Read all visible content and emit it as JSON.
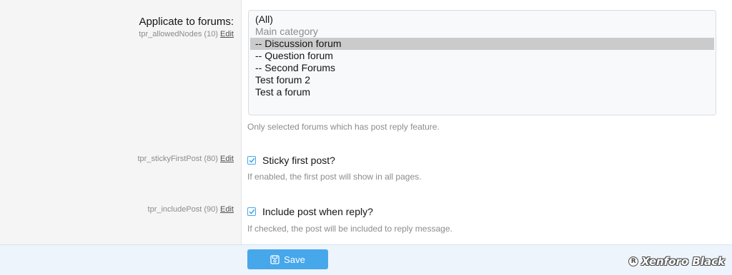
{
  "forums_field": {
    "label": "Applicate to forums:",
    "option_id": "tpr_allowedNodes (10)",
    "edit_label": "Edit",
    "options": [
      {
        "label": "(All)",
        "state": "normal"
      },
      {
        "label": "Main category",
        "state": "disabled"
      },
      {
        "label": "-- Discussion forum",
        "state": "selected"
      },
      {
        "label": "-- Question forum",
        "state": "normal"
      },
      {
        "label": "-- Second Forums",
        "state": "normal"
      },
      {
        "label": "Test forum 2",
        "state": "normal"
      },
      {
        "label": "Test a forum",
        "state": "normal"
      }
    ],
    "hint": "Only selected forums which has post reply feature."
  },
  "sticky_field": {
    "option_id": "tpr_stickyFirstPost (80)",
    "edit_label": "Edit",
    "checkbox_label": "Sticky first post?",
    "checked": true,
    "hint": "If enabled, the first post will show in all pages."
  },
  "include_field": {
    "option_id": "tpr_includePost (90)",
    "edit_label": "Edit",
    "checkbox_label": "Include post when reply?",
    "checked": true,
    "hint": "If checked, the post will be included to reply message."
  },
  "footer": {
    "save_label": "Save",
    "save_icon": "save-icon",
    "watermark_symbol": "R",
    "watermark_text": "Xenforo Black"
  },
  "colors": {
    "accent": "#47a7eb",
    "selected_option": "#cbcbcb",
    "footer_bg": "#edf4fb"
  }
}
